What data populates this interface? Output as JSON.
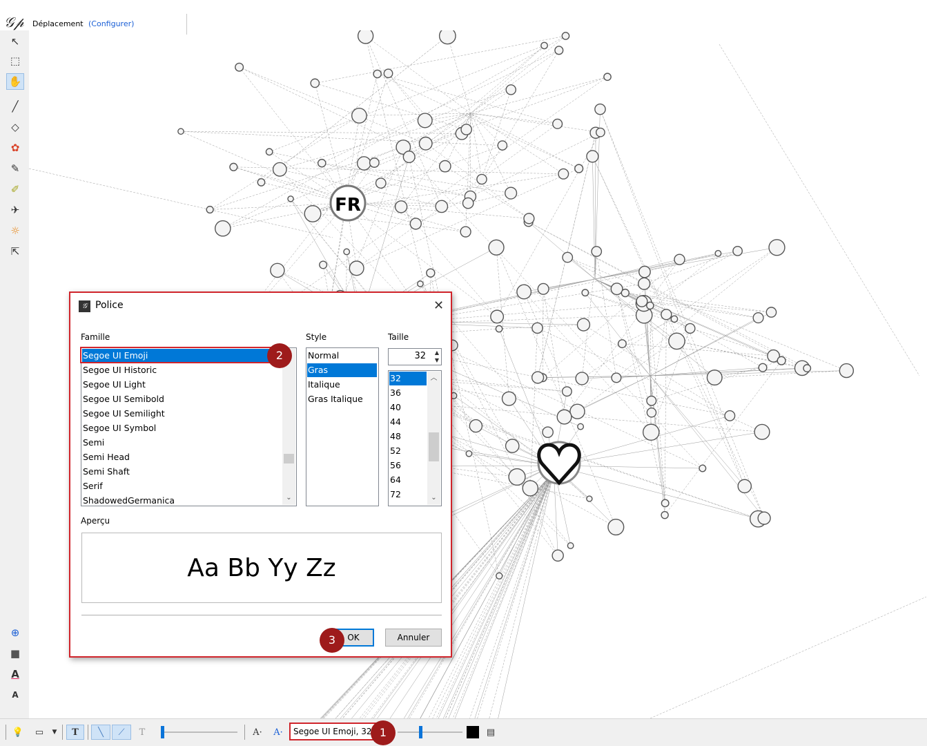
{
  "header": {
    "mode_label": "Déplacement",
    "configure_link": "(Configurer)"
  },
  "toolbar_left": {
    "tools": [
      {
        "name": "pointer-tool-icon",
        "glyph": "↖"
      },
      {
        "name": "rect-select-tool-icon",
        "glyph": "⬚"
      },
      {
        "name": "drag-hand-tool-icon",
        "glyph": "✋",
        "active": true
      },
      {
        "name": "brush-tool-icon",
        "glyph": "╱"
      },
      {
        "name": "diamond-tool-icon",
        "glyph": "◇"
      },
      {
        "name": "painter-tool-icon",
        "glyph": "✿"
      },
      {
        "name": "pencil-tool-icon",
        "glyph": "✎"
      },
      {
        "name": "highlighter-tool-icon",
        "glyph": "✐"
      },
      {
        "name": "plane-tool-icon",
        "glyph": "✈"
      },
      {
        "name": "sun-tool-icon",
        "glyph": "☼"
      },
      {
        "name": "help-pointer-tool-icon",
        "glyph": "⇱"
      }
    ],
    "bottom_tools": [
      {
        "name": "zoom-fit-tool-icon",
        "glyph": "⊕"
      },
      {
        "name": "background-color-tool-icon",
        "glyph": "■"
      },
      {
        "name": "label-color-tool-icon",
        "glyph": "A"
      },
      {
        "name": "label-size-tool-icon",
        "glyph": "A"
      }
    ]
  },
  "graph": {
    "hub_labels": [
      "FR"
    ]
  },
  "dialog": {
    "title": "Police",
    "family_label": "Famille",
    "style_label": "Style",
    "size_label": "Taille",
    "families": [
      "Segoe UI Emoji",
      "Segoe UI Historic",
      "Segoe UI Light",
      "Segoe UI Semibold",
      "Segoe UI Semilight",
      "Segoe UI Symbol",
      "Semi",
      "Semi Head",
      "Semi Shaft",
      "Serif",
      "ShadowedGermanica"
    ],
    "selected_family": "Segoe UI Emoji",
    "styles": [
      "Normal",
      "Gras",
      "Italique",
      "Gras Italique"
    ],
    "selected_style": "Gras",
    "size_value": "32",
    "sizes": [
      "32",
      "36",
      "40",
      "44",
      "48",
      "52",
      "56",
      "64",
      "72"
    ],
    "selected_size": "32",
    "preview_label": "Aperçu",
    "preview_text": "Aa Bb Yy Zz",
    "ok_label": "OK",
    "cancel_label": "Annuler"
  },
  "bottom_bar": {
    "font_field": "Segoe UI Emoji, 32",
    "text_smaller_label": "A·",
    "text_bigger_label": "A·"
  },
  "annotations": [
    "1",
    "2",
    "3"
  ],
  "colors": {
    "accent": "#0078d7",
    "highlight": "#d0242b",
    "badge": "#9e1b1b"
  }
}
